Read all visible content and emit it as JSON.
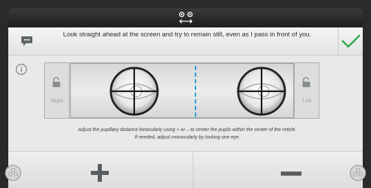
{
  "header": {
    "icon": "eyes-arrows-icon"
  },
  "instruction": {
    "text": "Look straight ahead at the screen and try to remain still, even as I pass in front of you.",
    "icon": "chat-bubble-icon",
    "confirm_icon": "checkmark-icon",
    "accent_color": "#2fa84a"
  },
  "reticle_area": {
    "left_lock_label": "Right",
    "right_lock_label": "Left",
    "center_line_color": "#1f9fd8"
  },
  "hint": {
    "line1": "Adjust the pupillary distance binocularly using + or – to center the pupils within the center of the reticle.",
    "line2": "If needed, adjust monocularly by locking one eye."
  },
  "controls": {
    "plus_icon": "plus-icon",
    "minus_icon": "minus-icon"
  }
}
